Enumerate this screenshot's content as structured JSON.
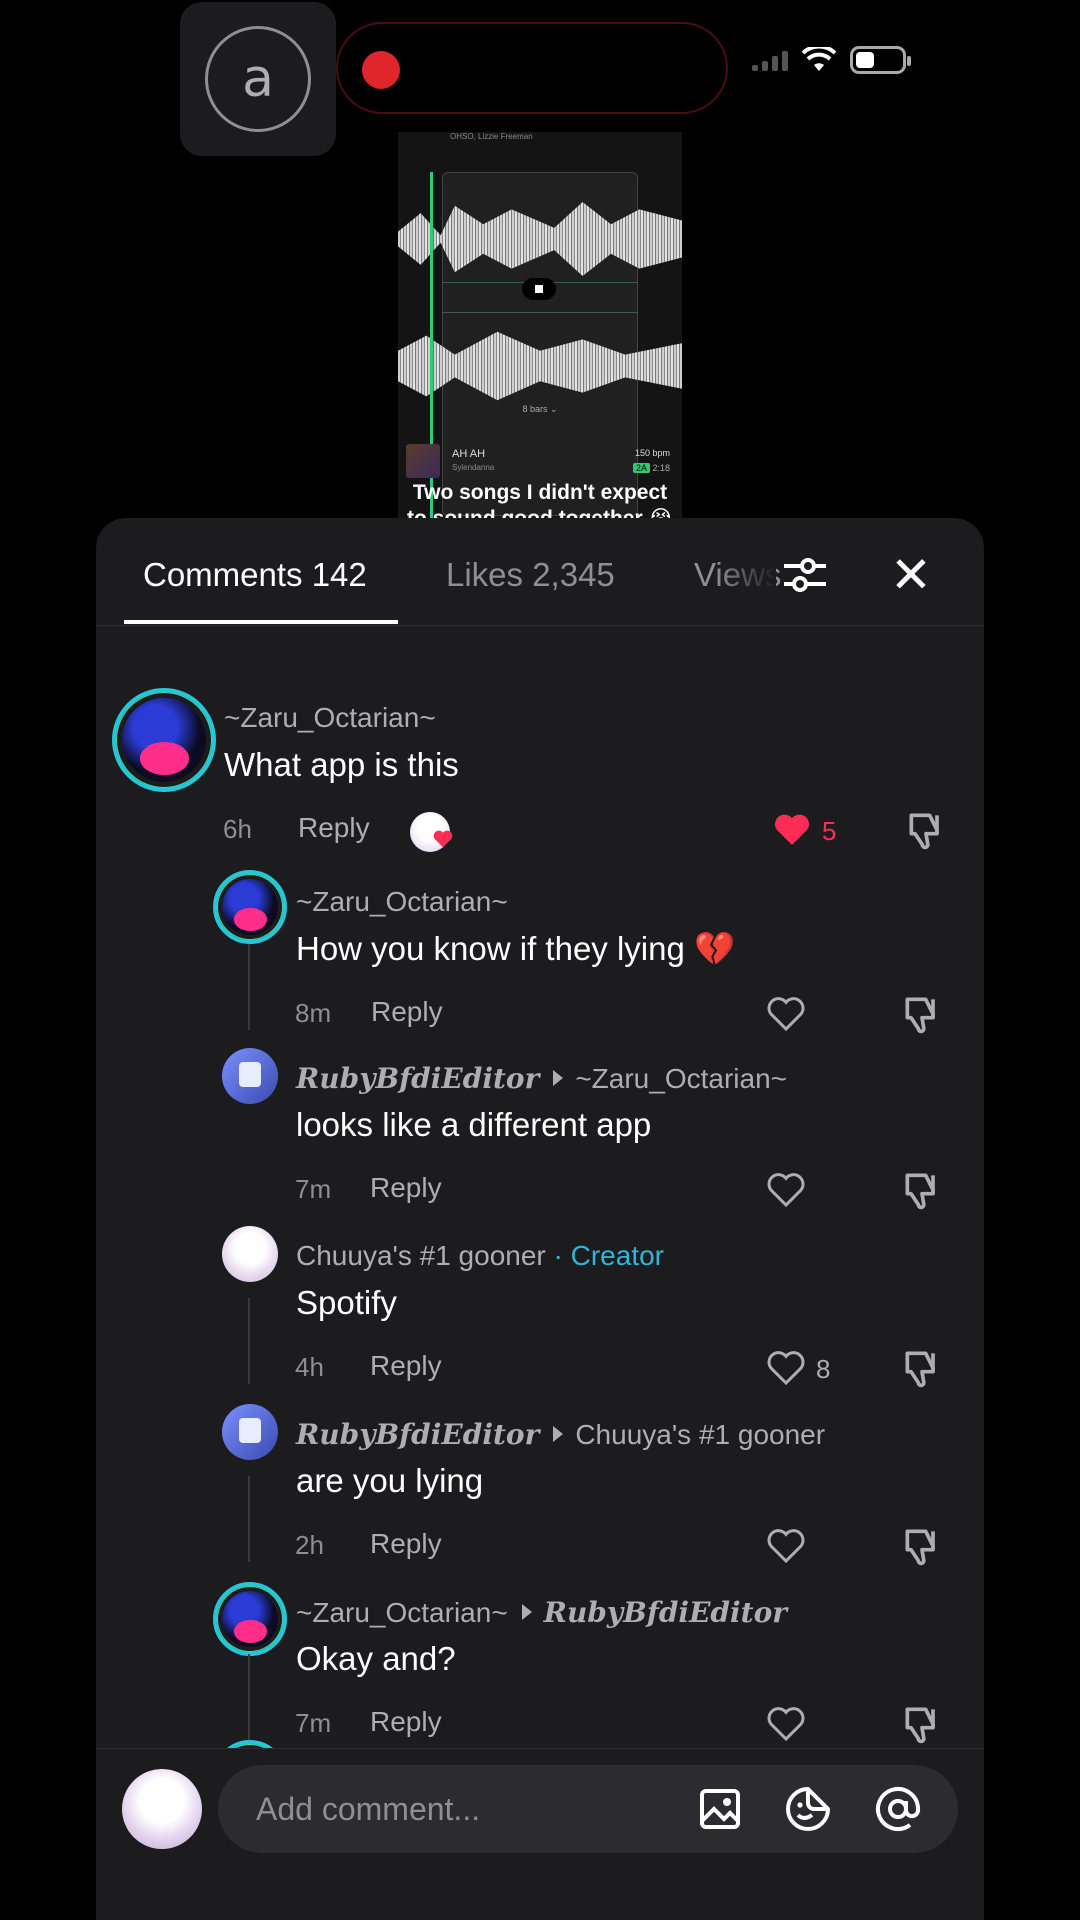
{
  "status": {
    "record_indicator": "recording"
  },
  "preview": {
    "top_text": "OHSO, Lizzie Freeman",
    "bars_label": "8 bars ⌄",
    "track_title": "AH AH",
    "track_artist": "Sylendanna",
    "track_bpm": "150 bpm",
    "track_key": "2A",
    "track_duration": "2:18",
    "caption_line1": "Two songs I didn't expect",
    "caption_line2": "to sound good together 😭"
  },
  "tabs": {
    "comments": "Comments 142",
    "likes": "Likes 2,345",
    "views": "Views"
  },
  "comments": [
    {
      "user": "~Zaru_Octarian~",
      "text": "What app is this",
      "time": "6h",
      "reply": "Reply",
      "likes": "5",
      "liked": true
    },
    {
      "user": "~Zaru_Octarian~",
      "text": "How you know if they lying 💔",
      "time": "8m",
      "reply": "Reply",
      "likes": ""
    },
    {
      "user": "RubyBfdiEditor",
      "reply_to": "~Zaru_Octarian~",
      "text": "looks like a different app",
      "time": "7m",
      "reply": "Reply",
      "likes": ""
    },
    {
      "user": "Chuuya's #1 gooner",
      "badge": "· Creator",
      "text": "Spotify",
      "time": "4h",
      "reply": "Reply",
      "likes": "8"
    },
    {
      "user": "RubyBfdiEditor",
      "reply_to": "Chuuya's #1 gooner",
      "text": "are you lying",
      "time": "2h",
      "reply": "Reply",
      "likes": ""
    },
    {
      "user": "~Zaru_Octarian~",
      "reply_to": "RubyBfdiEditor",
      "text": "Okay and?",
      "time": "7m",
      "reply": "Reply",
      "likes": ""
    }
  ],
  "input": {
    "placeholder": "Add comment..."
  },
  "colors": {
    "accent": "#ff2d55",
    "creator": "#2fb5d8",
    "sheet_bg": "#1c1c1e"
  }
}
